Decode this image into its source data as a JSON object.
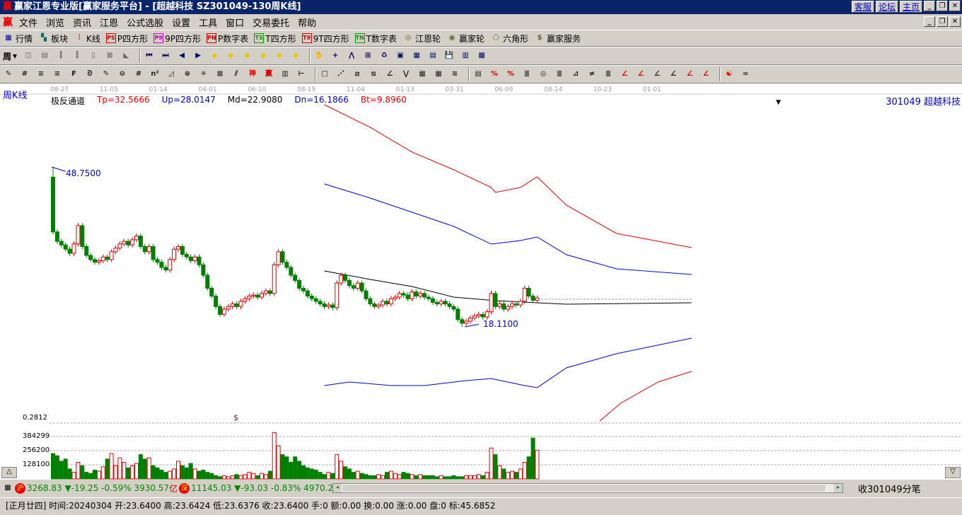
{
  "title": {
    "app": "赢家江恩专业版[赢家服务平台] - [超越科技   SZ301049-130周K线]",
    "links": [
      "客服",
      "论坛",
      "主页"
    ]
  },
  "menu": [
    "文件",
    "浏览",
    "资讯",
    "江恩",
    "公式选股",
    "设置",
    "工具",
    "窗口",
    "交易委托",
    "帮助"
  ],
  "toolbar1": [
    {
      "icon": "grid-icon",
      "label": "行情"
    },
    {
      "icon": "blocks-icon",
      "label": "板块"
    },
    {
      "icon": "candle-icon",
      "label": "K线"
    },
    {
      "icon": "ps-icon",
      "tag": "PS",
      "label": "P四方形"
    },
    {
      "icon": "p9-icon",
      "tag": "P9",
      "label": "9P四方形"
    },
    {
      "icon": "pn-icon",
      "tag": "PN",
      "label": "P数字表"
    },
    {
      "icon": "ts-icon",
      "tag": "TS",
      "label": "T四方形"
    },
    {
      "icon": "t9-icon",
      "tag": "T9",
      "label": "9T四方形"
    },
    {
      "icon": "tn-icon",
      "tag": "TN",
      "label": "T数字表"
    },
    {
      "icon": "wheel-icon",
      "label": "江恩轮"
    },
    {
      "icon": "big-wheel-icon",
      "label": "赢家轮"
    },
    {
      "icon": "hexagon-icon",
      "label": "六角形"
    },
    {
      "icon": "dollar-icon",
      "label": "赢家服务"
    }
  ],
  "period": "周",
  "chart": {
    "period_label": "周K线",
    "indicator_name": "极反通道",
    "tp": "Tp=32.5666",
    "up": "Up=28.0147",
    "md": "Md=22.9080",
    "dn": "Dn=16.1866",
    "bt": "Bt=9.8960",
    "stock": "301049  超越科技",
    "high_label": "48.7500",
    "low_label": "18.1100",
    "dates": [
      "08-27",
      "11-05",
      "01-14",
      "04-01",
      "06-10",
      "08-19",
      "11-04",
      "01-13",
      "03-31",
      "06-09",
      "08-14",
      "10-23",
      "01-01"
    ],
    "vol_labels": [
      "0.2812",
      "384299",
      "256200",
      "128100"
    ],
    "marker": "$"
  },
  "chart_data": {
    "type": "candlestick",
    "closes": [
      36.3,
      34.5,
      33.8,
      33.0,
      32.2,
      34.0,
      37.5,
      33.5,
      31.8,
      31.0,
      30.5,
      30.8,
      31.5,
      31.0,
      32.5,
      33.2,
      34.0,
      34.5,
      33.8,
      34.8,
      35.5,
      33.5,
      32.5,
      33.5,
      31.0,
      30.5,
      29.5,
      29.0,
      31.0,
      33.0,
      33.5,
      32.0,
      31.5,
      30.8,
      31.5,
      30.0,
      28.0,
      25.5,
      24.0,
      22.0,
      20.5,
      21.5,
      22.0,
      22.5,
      22.0,
      23.0,
      23.5,
      24.0,
      24.2,
      23.8,
      24.5,
      25.0,
      24.5,
      30.0,
      32.5,
      30.5,
      29.5,
      28.0,
      27.0,
      25.5,
      25.0,
      24.0,
      23.5,
      23.0,
      22.5,
      22.0,
      22.3,
      21.8,
      26.5,
      28.0,
      27.0,
      26.0,
      25.5,
      26.5,
      25.0,
      23.5,
      22.5,
      22.0,
      22.3,
      23.0,
      22.5,
      23.5,
      23.8,
      24.5,
      24.2,
      23.5,
      24.8,
      24.0,
      24.5,
      23.8,
      23.5,
      22.8,
      22.5,
      23.0,
      22.5,
      22.0,
      21.5,
      19.5,
      18.8,
      19.2,
      19.8,
      20.2,
      20.5,
      20.0,
      21.0,
      24.5,
      22.0,
      22.5,
      21.5,
      22.0,
      22.5,
      22.3,
      23.0,
      25.5,
      24.0,
      23.2,
      23.64
    ],
    "first_open": 46.8,
    "high": 48.75,
    "low": 18.11,
    "volumes": [
      230000,
      210000,
      160000,
      180000,
      90000,
      60000,
      150000,
      120000,
      60000,
      50000,
      80000,
      70000,
      110000,
      180000,
      230000,
      120000,
      190000,
      150000,
      100000,
      120000,
      140000,
      220000,
      180000,
      190000,
      120000,
      100000,
      80000,
      60000,
      70000,
      90000,
      160000,
      120000,
      100000,
      140000,
      90000,
      70000,
      80000,
      60000,
      50000,
      30000,
      20000,
      30000,
      20000,
      30000,
      40000,
      30000,
      40000,
      60000,
      50000,
      30000,
      50000,
      40000,
      70000,
      420000,
      300000,
      220000,
      200000,
      150000,
      200000,
      160000,
      120000,
      100000,
      90000,
      80000,
      60000,
      40000,
      60000,
      50000,
      220000,
      160000,
      110000,
      90000,
      60000,
      70000,
      50000,
      40000,
      30000,
      30000,
      40000,
      30000,
      60000,
      70000,
      50000,
      40000,
      60000,
      50000,
      40000,
      30000,
      40000,
      30000,
      30000,
      30000,
      20000,
      30000,
      20000,
      20000,
      30000,
      20000,
      20000,
      30000,
      30000,
      30000,
      40000,
      30000,
      60000,
      280000,
      220000,
      120000,
      90000,
      60000,
      70000,
      60000,
      90000,
      150000,
      200000,
      370000,
      260000
    ],
    "channels": [
      {
        "name": "Tp",
        "color": "#e00000",
        "x": [
          65,
          76,
          86,
          96,
          105,
          106,
          112,
          116,
          123,
          135,
          153
        ],
        "y": [
          60.68,
          56.34,
          51.6,
          48.21,
          44.82,
          43.87,
          44.82,
          46.85,
          41.43,
          36.01,
          33.3
        ]
      },
      {
        "name": "Up",
        "color": "#0000e0",
        "x": [
          65,
          76,
          86,
          96,
          105,
          112,
          116,
          123,
          135,
          153
        ],
        "y": [
          45.5,
          42.78,
          40.07,
          37.36,
          33.97,
          34.65,
          35.33,
          31.94,
          29.23,
          28.14
        ]
      },
      {
        "name": "Md",
        "color": "#000000",
        "x": [
          65,
          76,
          86,
          96,
          106,
          116,
          123,
          153
        ],
        "y": [
          28.82,
          27.2,
          25.84,
          23.8,
          23.13,
          22.72,
          22.45,
          22.72
        ]
      },
      {
        "name": "Dn",
        "color": "#0000e0",
        "x": [
          65,
          71,
          81,
          89,
          99,
          105,
          113,
          116,
          123,
          135,
          153
        ],
        "y": [
          6.86,
          7.54,
          6.86,
          6.86,
          7.8,
          8.2,
          6.86,
          6.45,
          10.25,
          12.96,
          15.94
        ]
      },
      {
        "name": "Bt",
        "color": "#e00000",
        "x": [
          131,
          136,
          145,
          153
        ],
        "y": [
          0.06,
          3.47,
          7.54,
          9.57
        ]
      }
    ]
  },
  "status": {
    "sh_tag": "沪",
    "sh": "3268.83 ▼-19.25 -0.59% 3930.57",
    "yi": "亿",
    "sz_tag": "深",
    "sz": "11145.03 ▼-93.03 -0.83% 4970.2",
    "right": "收301049分笔"
  },
  "info": "[正月廿四] 时间:20240304 开:23.6400 高:23.6424 低:23.6376 收:23.6400 手:0 额:0.00 换:0.00 涨:0.00 盘:0 标:45.6852"
}
